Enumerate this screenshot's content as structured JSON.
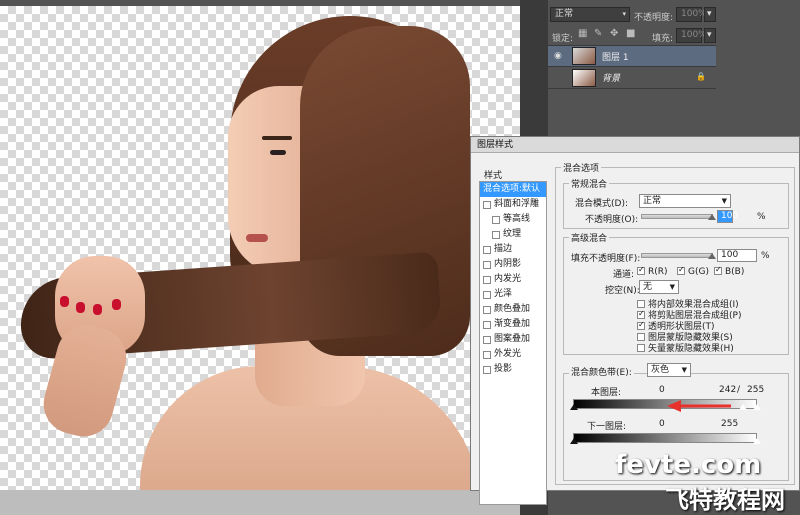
{
  "layers_panel": {
    "blend_mode": "正常",
    "opacity_label": "不透明度:",
    "opacity_value": "100%",
    "lock_label": "锁定:",
    "fill_label": "填充:",
    "fill_value": "100%",
    "layers": [
      {
        "name": "图层 1",
        "selected": true
      },
      {
        "name": "背景",
        "locked": true
      }
    ]
  },
  "dialog": {
    "title": "图层样式",
    "styles_header": "样式",
    "styles": [
      {
        "label": "混合选项:默认",
        "selected": true,
        "checkbox": false
      },
      {
        "label": "斜面和浮雕",
        "checkbox": true,
        "checked": false
      },
      {
        "label": "等高线",
        "checkbox": true,
        "checked": false,
        "indent": true
      },
      {
        "label": "纹理",
        "checkbox": true,
        "checked": false,
        "indent": true
      },
      {
        "label": "描边",
        "checkbox": true,
        "checked": false
      },
      {
        "label": "内阴影",
        "checkbox": true,
        "checked": false
      },
      {
        "label": "内发光",
        "checkbox": true,
        "checked": false
      },
      {
        "label": "光泽",
        "checkbox": true,
        "checked": false
      },
      {
        "label": "颜色叠加",
        "checkbox": true,
        "checked": false
      },
      {
        "label": "渐变叠加",
        "checkbox": true,
        "checked": false
      },
      {
        "label": "图案叠加",
        "checkbox": true,
        "checked": false
      },
      {
        "label": "外发光",
        "checkbox": true,
        "checked": false
      },
      {
        "label": "投影",
        "checkbox": true,
        "checked": false
      }
    ],
    "blend_options_title": "混合选项",
    "general_title": "常规混合",
    "blend_mode_label": "混合模式(D):",
    "blend_mode_value": "正常",
    "opacity_label": "不透明度(O):",
    "opacity_value": "100",
    "percent": "%",
    "advanced_title": "高级混合",
    "fill_opacity_label": "填充不透明度(F):",
    "fill_opacity_value": "100",
    "channels_label": "通道:",
    "channel_r": "R(R)",
    "channel_g": "G(G)",
    "channel_b": "B(B)",
    "knockout_label": "挖空(N):",
    "knockout_value": "无",
    "options": [
      {
        "label": "将内部效果混合成组(I)",
        "checked": false
      },
      {
        "label": "将剪贴图层混合成组(P)",
        "checked": true
      },
      {
        "label": "透明形状图层(T)",
        "checked": true
      },
      {
        "label": "图层蒙版隐藏效果(S)",
        "checked": false
      },
      {
        "label": "矢量蒙版隐藏效果(H)",
        "checked": false
      }
    ],
    "blend_if_label": "混合颜色带(E):",
    "blend_if_value": "灰色",
    "this_layer_label": "本图层:",
    "this_layer_low": "0",
    "this_layer_high": "242",
    "slash": "/",
    "this_layer_high2": "255",
    "underlying_label": "下一图层:",
    "underlying_low": "0",
    "underlying_high": "255"
  },
  "watermark": {
    "line1": "fevte.com",
    "line2": "飞特教程网"
  },
  "colors": {
    "accent": "#3399ff",
    "arrow": "#e8312c"
  }
}
